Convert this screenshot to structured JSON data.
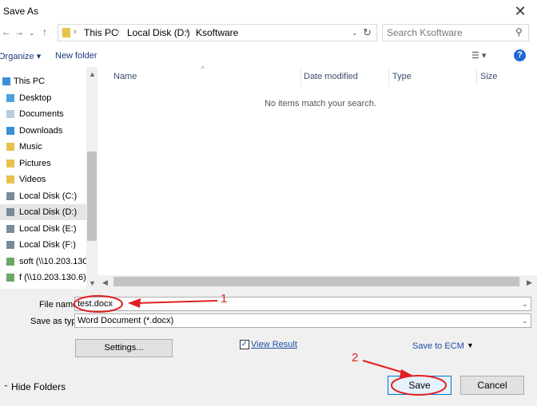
{
  "window": {
    "title": "Save As"
  },
  "address": {
    "crumbs": [
      "This PC",
      "Local Disk (D:)",
      "Ksoftware"
    ]
  },
  "search": {
    "placeholder": "Search Ksoftware"
  },
  "toolbar": {
    "organize": "Organize",
    "new_folder": "New folder"
  },
  "nav": {
    "items": [
      {
        "label": "This PC",
        "icon": "computer-icon",
        "color": "#3c8fd8"
      },
      {
        "label": "Desktop",
        "icon": "desktop-icon",
        "color": "#4aa3df"
      },
      {
        "label": "Documents",
        "icon": "documents-icon",
        "color": "#b9cbe0"
      },
      {
        "label": "Downloads",
        "icon": "downloads-icon",
        "color": "#3c8fd8"
      },
      {
        "label": "Music",
        "icon": "music-icon",
        "color": "#e7c24c"
      },
      {
        "label": "Pictures",
        "icon": "pictures-icon",
        "color": "#e7c24c"
      },
      {
        "label": "Videos",
        "icon": "videos-icon",
        "color": "#e7c24c"
      },
      {
        "label": "Local Disk (C:)",
        "icon": "drive-c-icon",
        "color": "#7a8a9a"
      },
      {
        "label": "Local Disk (D:)",
        "icon": "drive-icon",
        "color": "#7a8a9a"
      },
      {
        "label": "Local Disk (E:)",
        "icon": "drive-icon",
        "color": "#7a8a9a"
      },
      {
        "label": "Local Disk (F:)",
        "icon": "drive-icon",
        "color": "#7a8a9a"
      },
      {
        "label": "soft (\\\\10.203.130",
        "icon": "network-drive-icon",
        "color": "#6aa86a"
      },
      {
        "label": "f (\\\\10.203.130.6)",
        "icon": "network-drive-icon",
        "color": "#6aa86a"
      }
    ],
    "selected_index": 8
  },
  "columns": [
    "Name",
    "Date modified",
    "Type",
    "Size"
  ],
  "content": {
    "empty_message": "No items match your search."
  },
  "form": {
    "file_name_label": "File name:",
    "file_name_value": "test.docx",
    "save_type_label": "Save as type:",
    "save_type_value": "Word Document (*.docx)",
    "settings_label": "Settings...",
    "view_result_label": "View Result",
    "view_result_checked": true,
    "save_to_ecm_label": "Save to ECM"
  },
  "footer": {
    "hide_folders": "Hide Folders",
    "save_label": "Save",
    "cancel_label": "Cancel"
  },
  "annotations": {
    "step1": "1",
    "step2": "2",
    "color": "#e02020"
  }
}
